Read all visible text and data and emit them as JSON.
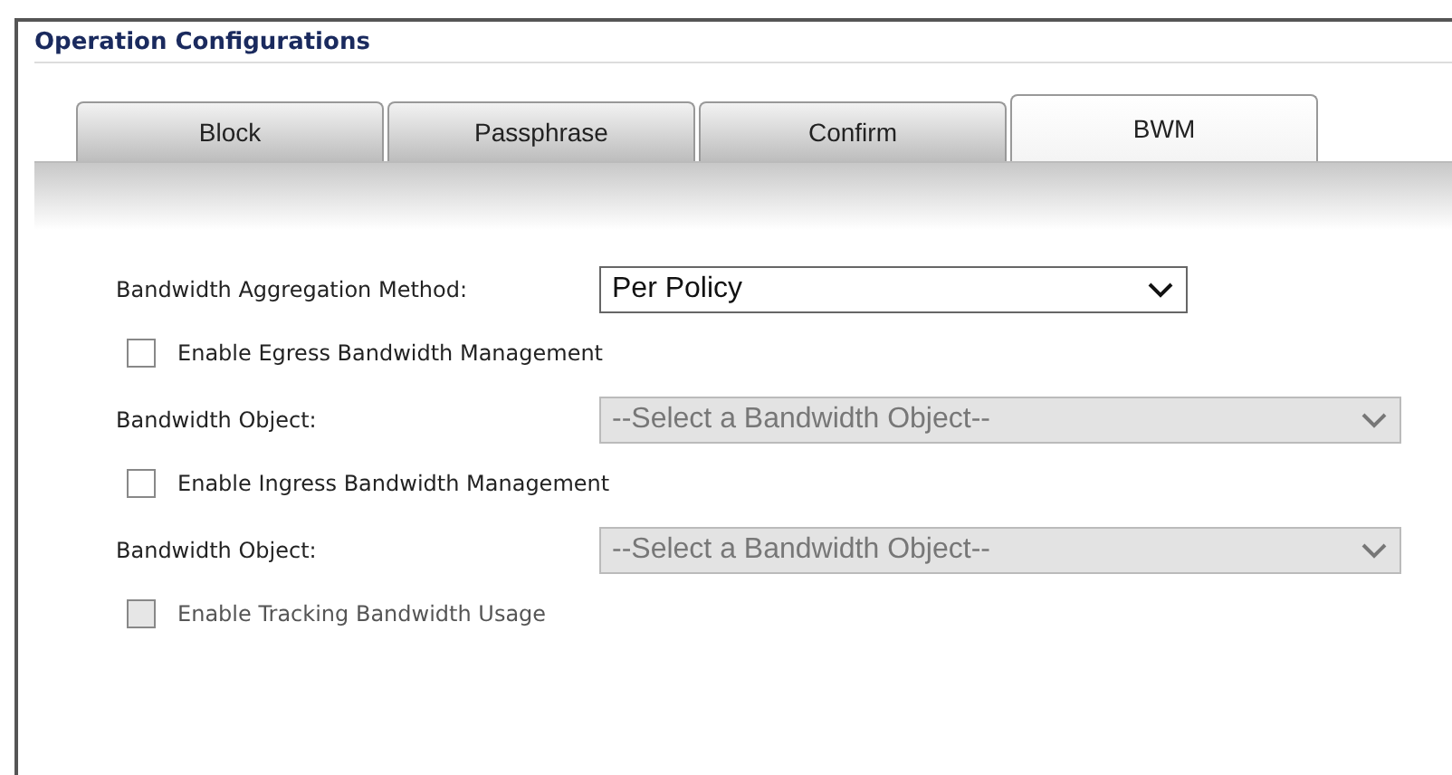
{
  "section": {
    "title": "Operation Configurations"
  },
  "tabs": [
    {
      "label": "Block",
      "selected": false
    },
    {
      "label": "Passphrase",
      "selected": false
    },
    {
      "label": "Confirm",
      "selected": false
    },
    {
      "label": "BWM",
      "selected": true
    }
  ],
  "form": [
    {
      "kind": "select",
      "label": "Bandwidth Aggregation Method:",
      "value": "Per Policy",
      "disabled": false
    },
    {
      "kind": "checkbox",
      "label": "Enable Egress Bandwidth Management",
      "checked": false,
      "disabled": false
    },
    {
      "kind": "select",
      "label": "Bandwidth Object:",
      "value": "--Select a Bandwidth Object--",
      "disabled": true
    },
    {
      "kind": "checkbox",
      "label": "Enable Ingress Bandwidth Management",
      "checked": false,
      "disabled": false
    },
    {
      "kind": "select",
      "label": "Bandwidth Object:",
      "value": "--Select a Bandwidth Object--",
      "disabled": true
    },
    {
      "kind": "checkbox",
      "label": "Enable Tracking Bandwidth Usage",
      "checked": false,
      "disabled": true
    }
  ]
}
